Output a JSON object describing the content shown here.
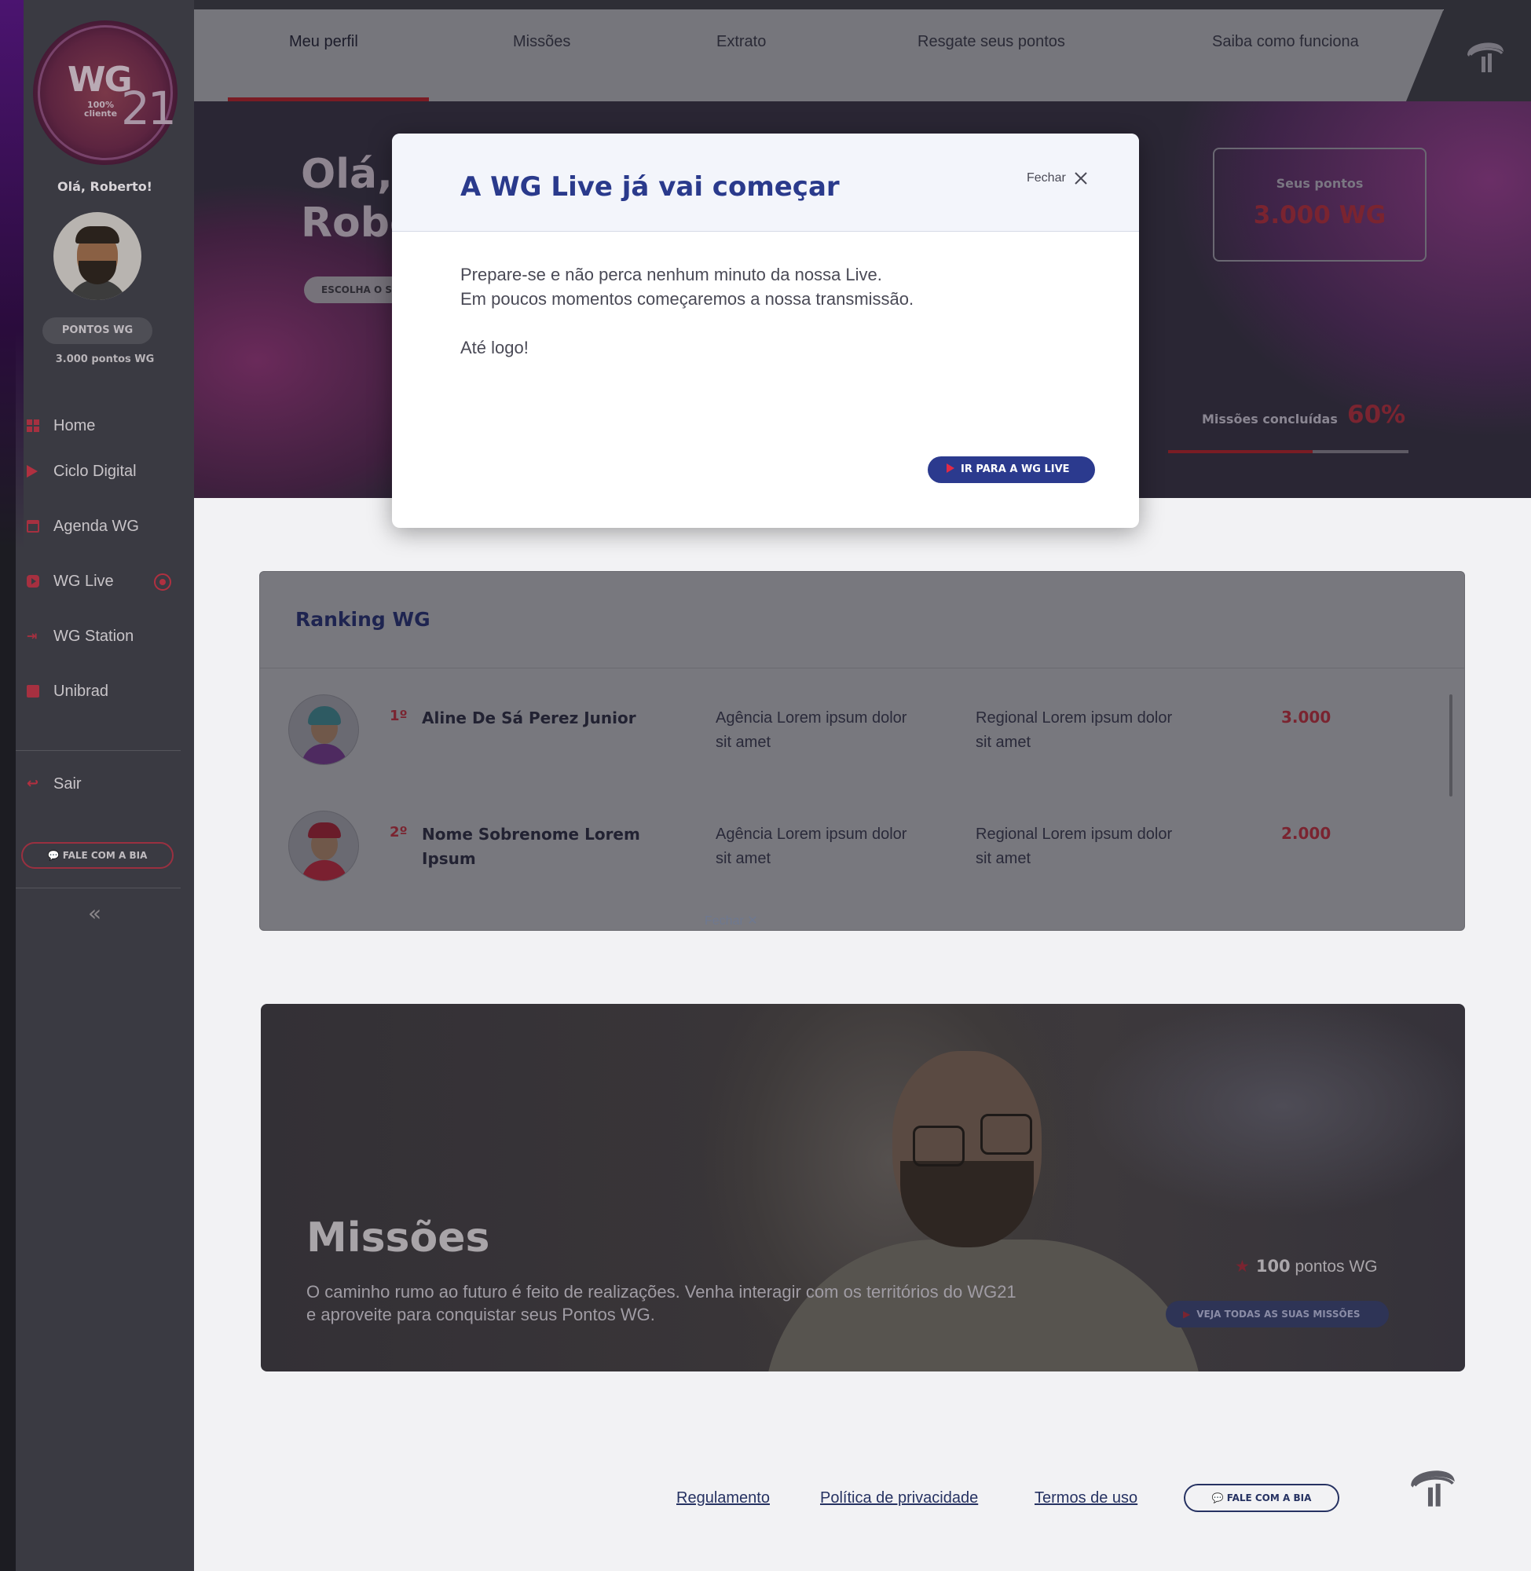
{
  "sidebar": {
    "logo": {
      "wg": "WG",
      "number": "21",
      "sub": "100% cliente"
    },
    "greeting": "Olá, Roberto!",
    "points_pill": "PONTOS WG",
    "points_text": "3.000 pontos WG",
    "items": [
      {
        "label": "Home",
        "icon": "home-icon"
      },
      {
        "label": "Ciclo Digital",
        "icon": "play-icon"
      },
      {
        "label": "Agenda WG",
        "icon": "calendar-icon"
      },
      {
        "label": "WG Live",
        "icon": "video-icon",
        "live": true
      },
      {
        "label": "WG Station",
        "icon": "station-icon"
      },
      {
        "label": "Unibrad",
        "icon": "book-icon"
      }
    ],
    "logout": "Sair",
    "bia_button": "FALE COM A BIA",
    "collapse": "«"
  },
  "topnav": {
    "tabs": [
      {
        "label": "Meu perfil",
        "active": true
      },
      {
        "label": "Missões"
      },
      {
        "label": "Extrato"
      },
      {
        "label": "Resgate seus pontos"
      },
      {
        "label": "Saiba como funciona"
      }
    ]
  },
  "hero": {
    "title_line1": "Olá,",
    "title_line2": "Robe",
    "pill": "ESCOLHA O S",
    "points_label": "Seus pontos",
    "points_value": "3.000 WG",
    "missions_label": "Missões concluídas",
    "missions_value": "60%",
    "missions_fraction": 0.6
  },
  "ranking": {
    "title": "Ranking WG",
    "rows": [
      {
        "pos": "1º",
        "name": "Aline De Sá Perez Junior",
        "agency": "Agência Lorem ipsum dolor sit amet",
        "regional": "Regional Lorem ipsum dolor sit amet",
        "points": "3.000"
      },
      {
        "pos": "2º",
        "name": "Nome Sobrenome Lorem Ipsum",
        "agency": "Agência Lorem ipsum dolor sit amet",
        "regional": "Regional Lorem ipsum dolor sit amet",
        "points": "2.000"
      }
    ],
    "ghost_close": "Fechar  ✕"
  },
  "missoes": {
    "title": "Missões",
    "description": "O caminho rumo ao futuro é feito de realizações. Venha interagir com os territórios do WG21 e aproveite para conquistar seus Pontos WG.",
    "points_number": "100",
    "points_suffix": " pontos WG",
    "button": "VEJA TODAS AS SUAS MISSÕES"
  },
  "footer": {
    "links": [
      "Regulamento",
      "Política de privacidade",
      "Termos de uso"
    ],
    "bia_button": "FALE COM A BIA"
  },
  "modal": {
    "title": "A WG Live já vai começar",
    "close_label": "Fechar",
    "line1": "Prepare-se e não perca nenhum minuto da nossa Live.",
    "line2": "Em poucos momentos começaremos a nossa transmissão.",
    "line3": "Até logo!",
    "cta": "IR PARA A WG LIVE"
  },
  "colors": {
    "accent_red": "#e02a46",
    "brand_blue": "#2b3a8e",
    "overlay_dark": "#2a2634"
  }
}
